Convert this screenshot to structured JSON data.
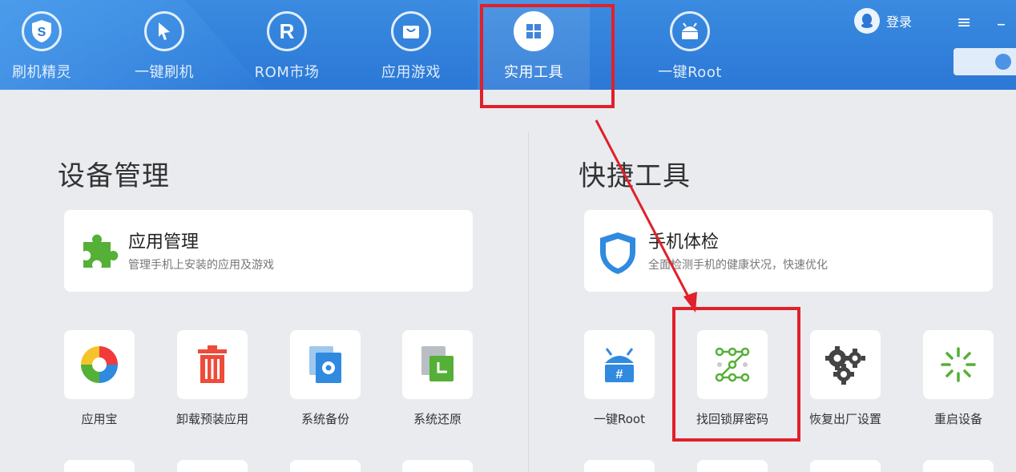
{
  "nav": {
    "items": [
      {
        "label": "刷机精灵",
        "icon": "shield-s-icon"
      },
      {
        "label": "一键刷机",
        "icon": "cursor-arrow-icon"
      },
      {
        "label": "ROM市场",
        "icon": "r-letter-icon"
      },
      {
        "label": "应用游戏",
        "icon": "bag-icon"
      },
      {
        "label": "实用工具",
        "icon": "grid-icon"
      },
      {
        "label": "一键Root",
        "icon": "android-icon"
      }
    ],
    "login_label": "登录"
  },
  "device_management": {
    "title": "设备管理",
    "card": {
      "title": "应用管理",
      "subtitle": "管理手机上安装的应用及游戏"
    },
    "tiles": [
      {
        "label": "应用宝"
      },
      {
        "label": "卸载预装应用"
      },
      {
        "label": "系统备份"
      },
      {
        "label": "系统还原"
      }
    ]
  },
  "quick_tools": {
    "title": "快捷工具",
    "card": {
      "title": "手机体检",
      "subtitle": "全面检测手机的健康状况，快速优化"
    },
    "tiles": [
      {
        "label": "一键Root"
      },
      {
        "label": "找回锁屏密码"
      },
      {
        "label": "恢复出厂设置"
      },
      {
        "label": "重启设备"
      }
    ]
  },
  "colors": {
    "topbar": "#2b78d6",
    "annotation_red": "#e0202a",
    "accent_green": "#54b036",
    "accent_blue": "#2f8ae0"
  }
}
